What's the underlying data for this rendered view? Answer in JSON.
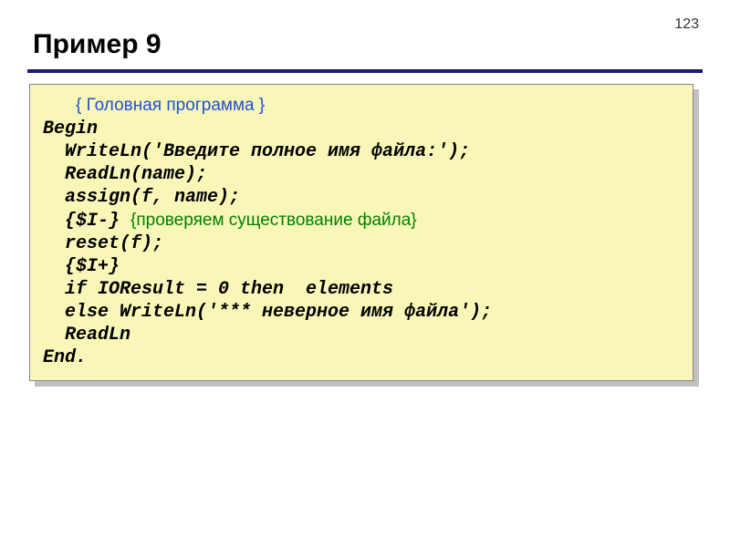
{
  "page_number": "123",
  "title": "Пример 9",
  "code": {
    "line1_comment": "{ Головная программа }",
    "line1_indent": "   ",
    "line2": "Begin",
    "line3": "  WriteLn('Введите полное имя файла:');",
    "line4": "  ReadLn(name);",
    "line5": "  assign(f, name);",
    "line6_code": "  {$I-} ",
    "line6_comment": "{проверяем существование файла}",
    "line7": "  reset(f);",
    "line8": "  {$I+}",
    "line9": "  if IOResult = 0 then  elements",
    "line10": "  else WriteLn('*** неверное имя файла');",
    "line11": "  ReadLn",
    "line12": "End."
  }
}
